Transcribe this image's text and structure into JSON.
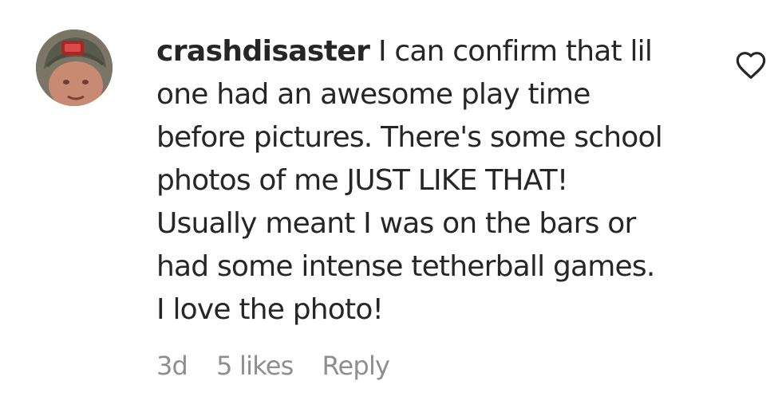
{
  "comment": {
    "avatar_icon": "user-avatar-photo",
    "username": "crashdisaster",
    "text": "I can confirm that lil\none had an awesome play time\nbefore pictures. There's some school\nphotos of me JUST LIKE THAT!\nUsually meant I was on the bars or\nhad some intense tetherball games.\nI love the photo!",
    "time_ago": "3d",
    "likes": "5 likes",
    "reply_label": "Reply",
    "like_icon": "heart-outline-icon"
  },
  "colors": {
    "text": "#262626",
    "meta": "#8e8e8e"
  }
}
